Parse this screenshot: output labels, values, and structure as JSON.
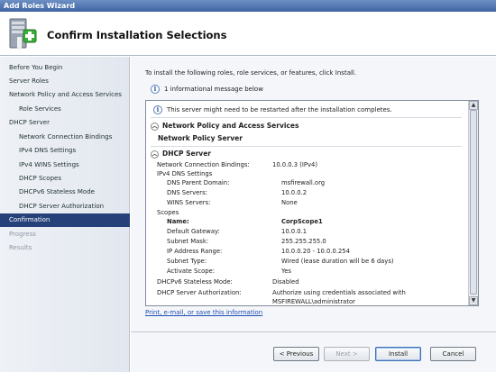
{
  "window": {
    "title": "Add Roles Wizard"
  },
  "header": {
    "title": "Confirm Installation Selections",
    "icon": "server-roles-add-icon"
  },
  "sidebar": {
    "items": [
      {
        "label": "Before You Begin",
        "level": 1,
        "state": "normal"
      },
      {
        "label": "Server Roles",
        "level": 1,
        "state": "normal"
      },
      {
        "label": "Network Policy and Access Services",
        "level": 1,
        "state": "normal"
      },
      {
        "label": "Role Services",
        "level": 2,
        "state": "normal"
      },
      {
        "label": "DHCP Server",
        "level": 1,
        "state": "normal"
      },
      {
        "label": "Network Connection Bindings",
        "level": 2,
        "state": "normal"
      },
      {
        "label": "IPv4 DNS Settings",
        "level": 2,
        "state": "normal"
      },
      {
        "label": "IPv4 WINS Settings",
        "level": 2,
        "state": "normal"
      },
      {
        "label": "DHCP Scopes",
        "level": 2,
        "state": "normal"
      },
      {
        "label": "DHCPv6 Stateless Mode",
        "level": 2,
        "state": "normal"
      },
      {
        "label": "DHCP Server Authorization",
        "level": 2,
        "state": "normal"
      },
      {
        "label": "Confirmation",
        "level": 1,
        "state": "active"
      },
      {
        "label": "Progress",
        "level": 1,
        "state": "disabled"
      },
      {
        "label": "Results",
        "level": 1,
        "state": "disabled"
      }
    ]
  },
  "main": {
    "intro": "To install the following roles, role services, or features, click Install.",
    "info_message": "1 informational message below",
    "warning": "This server might need to be restarted after the installation completes.",
    "sections": {
      "npas": {
        "title": "Network Policy and Access Services",
        "subitem": "Network Policy Server"
      },
      "dhcp": {
        "title": "DHCP Server",
        "bindings": {
          "label": "Network Connection Bindings:",
          "value": "10.0.0.3 (IPv4)"
        },
        "dns_heading": "IPv4 DNS Settings",
        "dns_domain": {
          "label": "DNS Parent Domain:",
          "value": "msfirewall.org"
        },
        "dns_servers": {
          "label": "DNS Servers:",
          "value": "10.0.0.2"
        },
        "wins_servers": {
          "label": "WINS Servers:",
          "value": "None"
        },
        "scopes_heading": "Scopes",
        "scope_name": {
          "label": "Name:",
          "value": "CorpScope1"
        },
        "gateway": {
          "label": "Default Gateway:",
          "value": "10.0.0.1"
        },
        "subnet_mask": {
          "label": "Subnet Mask:",
          "value": "255.255.255.0"
        },
        "ip_range": {
          "label": "IP Address Range:",
          "value": "10.0.0.20 - 10.0.0.254"
        },
        "subnet_type": {
          "label": "Subnet Type:",
          "value": "Wired (lease duration will be 6 days)"
        },
        "activate": {
          "label": "Activate Scope:",
          "value": "Yes"
        },
        "dhcpv6": {
          "label": "DHCPv6 Stateless Mode:",
          "value": "Disabled"
        },
        "authorization": {
          "label": "DHCP Server Authorization:",
          "value": "Authorize using credentials associated with",
          "value_cont": "MSFIREWALL\\administrator"
        }
      }
    },
    "link": "Print, e-mail, or save this information"
  },
  "buttons": {
    "previous": "< Previous",
    "next": "Next >",
    "install": "Install",
    "cancel": "Cancel"
  }
}
